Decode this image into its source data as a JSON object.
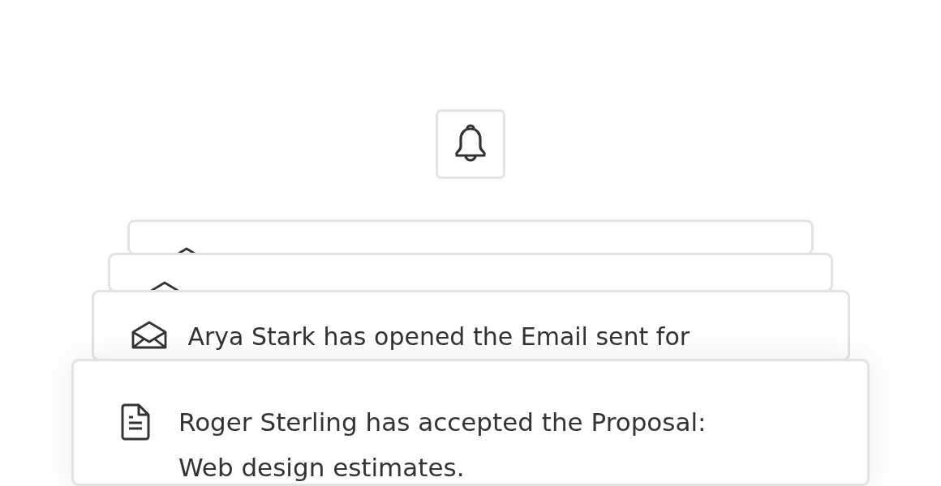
{
  "bell_button": {
    "kind": "bell"
  },
  "notifications": [
    {
      "kind": "email"
    },
    {
      "kind": "email"
    },
    {
      "kind": "email",
      "text": "Arya Stark has opened the Email sent for"
    },
    {
      "kind": "document",
      "text": "Roger Sterling has accepted the Proposal: Web design estimates."
    }
  ]
}
